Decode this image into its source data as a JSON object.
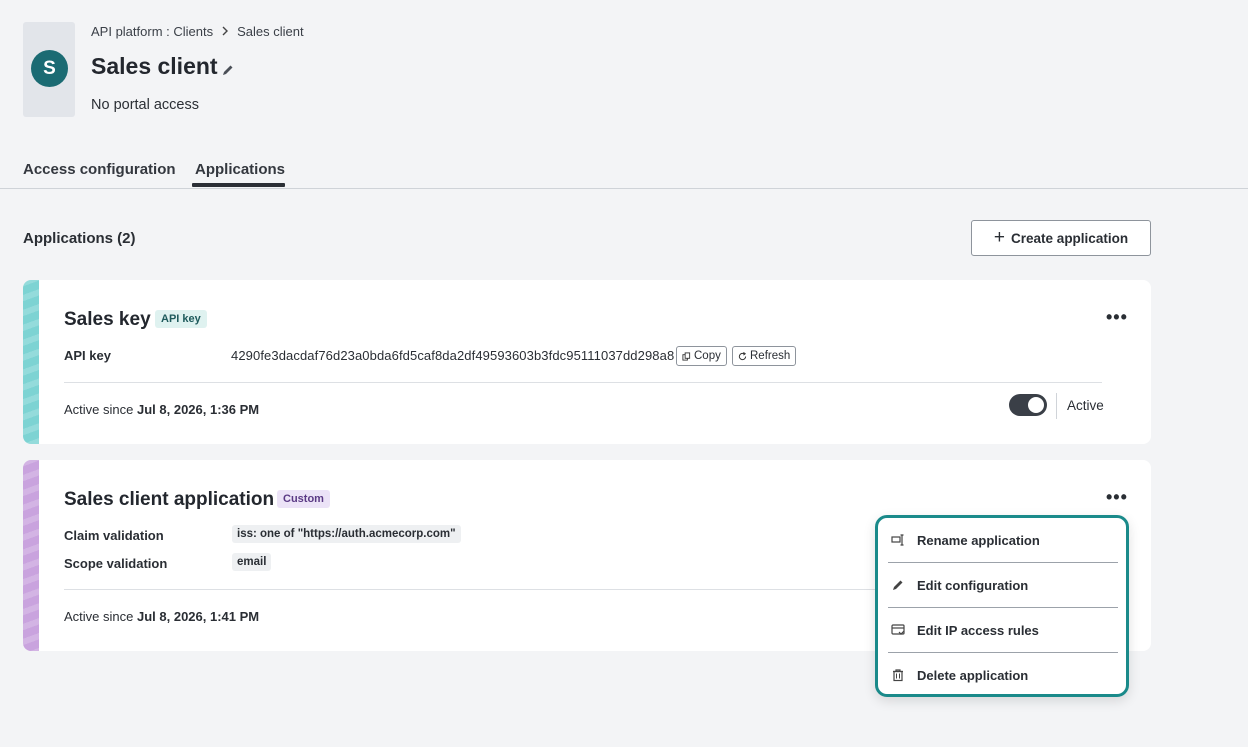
{
  "header": {
    "avatar_letter": "S",
    "breadcrumb": [
      "API platform : Clients",
      "Sales client"
    ],
    "title": "Sales client",
    "subtitle": "No portal access"
  },
  "tabs": [
    {
      "label": "Access configuration",
      "active": false
    },
    {
      "label": "Applications",
      "active": true
    }
  ],
  "section": {
    "title": "Applications (2)",
    "create_button": "Create application"
  },
  "cards": [
    {
      "title": "Sales key",
      "badge": "API key",
      "rows": [
        {
          "label": "API key",
          "value": "4290fe3dacdaf76d23a0bda6fd5caf8da2df49593603b3fdc95111037dd298a8"
        }
      ],
      "copy_label": "Copy",
      "refresh_label": "Refresh",
      "since_prefix": "Active since",
      "since_date": "Jul 8, 2026, 1:36 PM",
      "status": "Active",
      "active": true
    },
    {
      "title": "Sales client application",
      "badge": "Custom",
      "rows": [
        {
          "label": "Claim validation",
          "value": "iss: one of \"https://auth.acmecorp.com\""
        },
        {
          "label": "Scope validation",
          "value": "email"
        }
      ],
      "since_prefix": "Active since",
      "since_date": "Jul 8, 2026, 1:41 PM"
    }
  ],
  "menu": {
    "items": [
      {
        "label": "Rename application",
        "icon": "rename-icon"
      },
      {
        "label": "Edit configuration",
        "icon": "pencil-icon"
      },
      {
        "label": "Edit IP access rules",
        "icon": "ip-rules-icon"
      },
      {
        "label": "Delete application",
        "icon": "trash-icon"
      }
    ]
  },
  "colors": {
    "accent": "#1a8a8a",
    "avatar": "#1b6b73",
    "stripe_teal": "#7dd3d3",
    "stripe_purple": "#c9a3de"
  }
}
